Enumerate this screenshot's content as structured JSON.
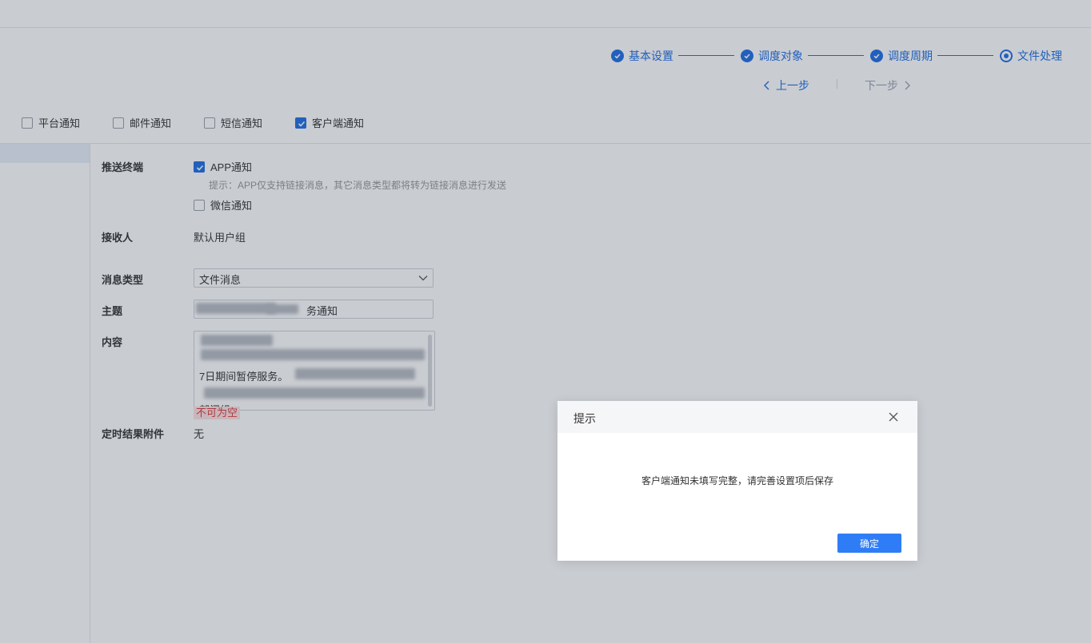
{
  "steps": [
    {
      "label": "基本设置",
      "state": "done"
    },
    {
      "label": "调度对象",
      "state": "done"
    },
    {
      "label": "调度周期",
      "state": "done"
    },
    {
      "label": "文件处理",
      "state": "current"
    }
  ],
  "nav": {
    "prev_label": "上一步",
    "next_label": "下一步"
  },
  "notify_types": [
    {
      "label": "平台通知",
      "checked": false
    },
    {
      "label": "邮件通知",
      "checked": false
    },
    {
      "label": "短信通知",
      "checked": false
    },
    {
      "label": "客户端通知",
      "checked": true
    }
  ],
  "form": {
    "push_terminal_label": "推送终端",
    "app_option": "APP通知",
    "app_hint": "提示：APP仅支持链接消息，其它消息类型都将转为链接消息进行发送",
    "wechat_option": "微信通知",
    "receiver_label": "接收人",
    "receiver_value": "默认用户组",
    "msg_type_label": "消息类型",
    "msg_type_value": "文件消息",
    "subject_label": "主题",
    "subject_value_visible": "务通知",
    "content_label": "内容",
    "content_visible_line": "7日期间暂停服务。",
    "content_visible_line2": "部门组",
    "content_error": "不可为空",
    "attachment_label": "定时结果附件",
    "attachment_value": "无"
  },
  "modal": {
    "title": "提示",
    "message": "客户端通知未填写完整，请完善设置项后保存",
    "ok_label": "确定"
  },
  "colors": {
    "accent": "#1f6fe5",
    "button": "#2f7df6",
    "error": "#e03b3b"
  }
}
